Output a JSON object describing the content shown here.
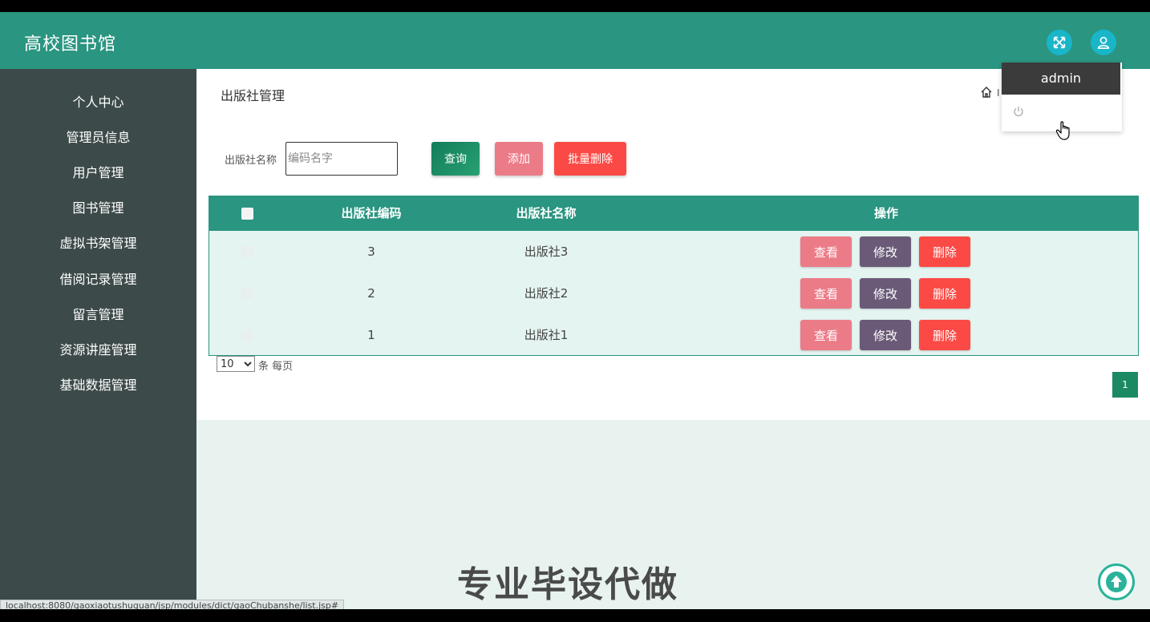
{
  "app": {
    "title": "高校图书馆"
  },
  "header": {
    "fullscreen_icon": "fullscreen-icon",
    "user_icon": "user-icon",
    "accent": "#2a9580"
  },
  "user_menu": {
    "username": "admin",
    "logout_icon": "power-icon"
  },
  "sidebar": {
    "items": [
      {
        "label": "个人中心"
      },
      {
        "label": "管理员信息"
      },
      {
        "label": "用户管理"
      },
      {
        "label": "图书管理"
      },
      {
        "label": "虚拟书架管理"
      },
      {
        "label": "借阅记录管理"
      },
      {
        "label": "留言管理"
      },
      {
        "label": "资源讲座管理"
      },
      {
        "label": "基础数据管理"
      }
    ]
  },
  "page": {
    "title": "出版社管理",
    "breadcrumb_fragment": "I"
  },
  "search": {
    "label": "出版社名称",
    "placeholder": "编码名字",
    "value": ""
  },
  "toolbar": {
    "query_label": "查询",
    "add_label": "添加",
    "batch_delete_label": "批量删除"
  },
  "table": {
    "headers": {
      "code": "出版社编码",
      "name": "出版社名称",
      "actions": "操作"
    },
    "rows": [
      {
        "code": "3",
        "name": "出版社3"
      },
      {
        "code": "2",
        "name": "出版社2"
      },
      {
        "code": "1",
        "name": "出版社1"
      }
    ],
    "row_actions": {
      "view": "查看",
      "edit": "修改",
      "delete": "删除"
    }
  },
  "pagination": {
    "page_size": "10",
    "page_size_options": [
      "10"
    ],
    "per_page_label": "条 每页",
    "current_page": "1"
  },
  "watermark": "专业毕设代做",
  "status_bar": {
    "url": "localhost:8080/gaoxiaotushuguan/jsp/modules/dict/gaoChubanshe/list.jsp#"
  }
}
